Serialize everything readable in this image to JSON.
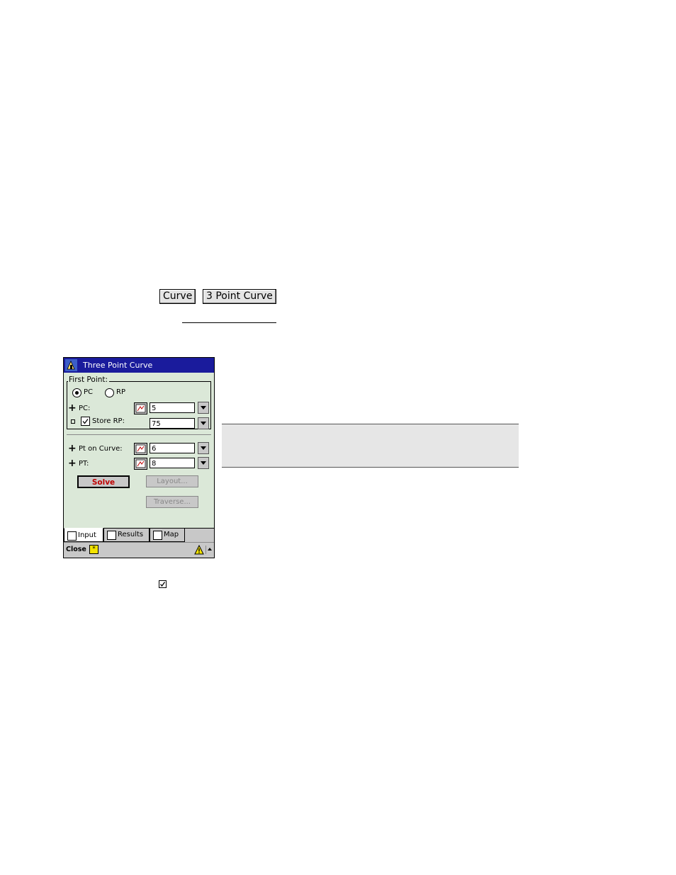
{
  "doc": {
    "curve_button": "Curve",
    "three_point_curve_button": "3 Point Curve"
  },
  "window": {
    "title": "Three Point Curve",
    "group_label": "First Point:",
    "radio_pc": "PC",
    "radio_rp": "RP",
    "selected_radio": "PC",
    "pc_label": "PC:",
    "pc_value": "5",
    "store_rp_label": "Store RP:",
    "store_rp_checked": true,
    "store_rp_value": "75",
    "pt_on_curve_label": "Pt on Curve:",
    "pt_on_curve_value": "6",
    "pt_label": "PT:",
    "pt_value": "8",
    "solve_label": "Solve",
    "layout_label": "Layout...",
    "traverse_label": "Traverse...",
    "tabs": [
      {
        "label": "Input",
        "active": true,
        "icon": "input-tab-icon"
      },
      {
        "label": "Results",
        "active": false,
        "icon": "results-tab-icon"
      },
      {
        "label": "Map",
        "active": false,
        "icon": "map-tab-icon"
      }
    ],
    "close_label": "Close",
    "accent_title_bar": "#1a1b9c",
    "solve_text_color": "#c00000"
  }
}
